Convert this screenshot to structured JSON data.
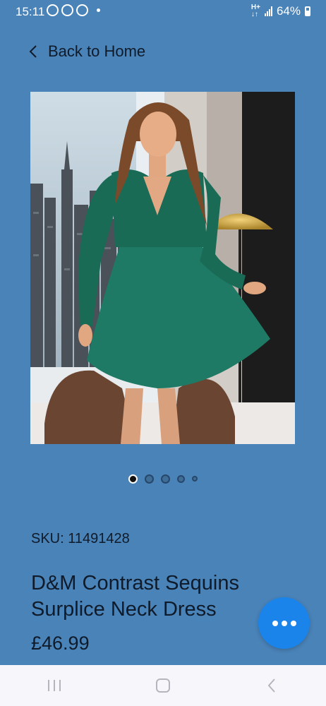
{
  "status_bar": {
    "time": "15:11",
    "battery": "64%",
    "icons": [
      "messenger-icon",
      "viber-icon",
      "viber-icon",
      "notification-dot-icon",
      "mobile-data-icon",
      "signal-icon",
      "battery-icon"
    ]
  },
  "header": {
    "back_label": "Back to Home",
    "back_icon": "chevron-left-icon"
  },
  "product": {
    "image_alt": "",
    "carousel": {
      "count": 5,
      "active_index": 0
    },
    "sku_label": "SKU: 11491428",
    "title": "D&M Contrast Sequins Surplice Neck Dress",
    "price": "£46.99"
  },
  "fab": {
    "icon": "more-horizontal-icon"
  },
  "nav_bar": {
    "icons": [
      "recent-apps-icon",
      "home-icon",
      "back-icon"
    ]
  },
  "colors": {
    "background": "#4a83b8",
    "fab": "#1a84ea",
    "dress": "#1e7a64",
    "text": "#0f1b2a"
  }
}
